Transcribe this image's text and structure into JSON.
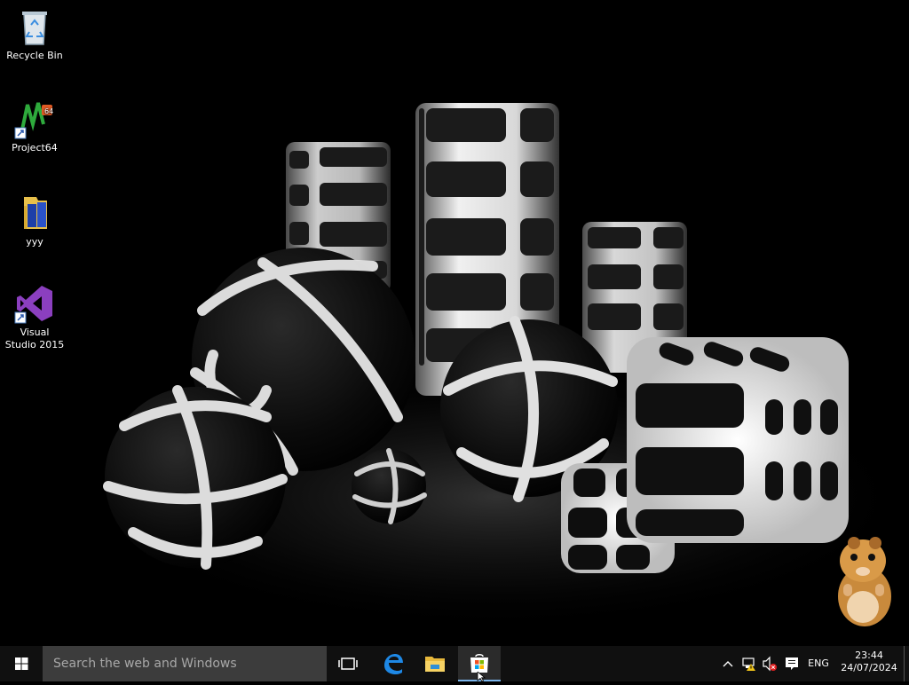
{
  "desktop": {
    "icons": [
      {
        "label": "Recycle Bin",
        "icon": "recycle-bin-icon"
      },
      {
        "label": "Project64",
        "icon": "project64-icon",
        "shortcut": true
      },
      {
        "label": "yyy",
        "icon": "folder-icon"
      },
      {
        "label": "Visual Studio 2015",
        "icon": "visual-studio-icon",
        "shortcut": true
      }
    ],
    "wallpaper": "glowing-3d-shapes-wallpaper",
    "mascot": "hamster-mascot"
  },
  "taskbar": {
    "search_placeholder": "Search the web and Windows",
    "pinned": [
      "task-view-icon",
      "edge-icon",
      "file-explorer-icon",
      "store-icon"
    ],
    "active": "store-icon",
    "tray": {
      "language": "ENG",
      "time": "23:44",
      "date": "24/07/2024"
    }
  },
  "colors": {
    "taskbar_bg": "#101010",
    "search_bg": "#3c3c3c",
    "accent": "#7ab4ea",
    "visual_studio": "#68217a",
    "edge_blue": "#1e88e5",
    "folder_yellow": "#e8c04a"
  }
}
